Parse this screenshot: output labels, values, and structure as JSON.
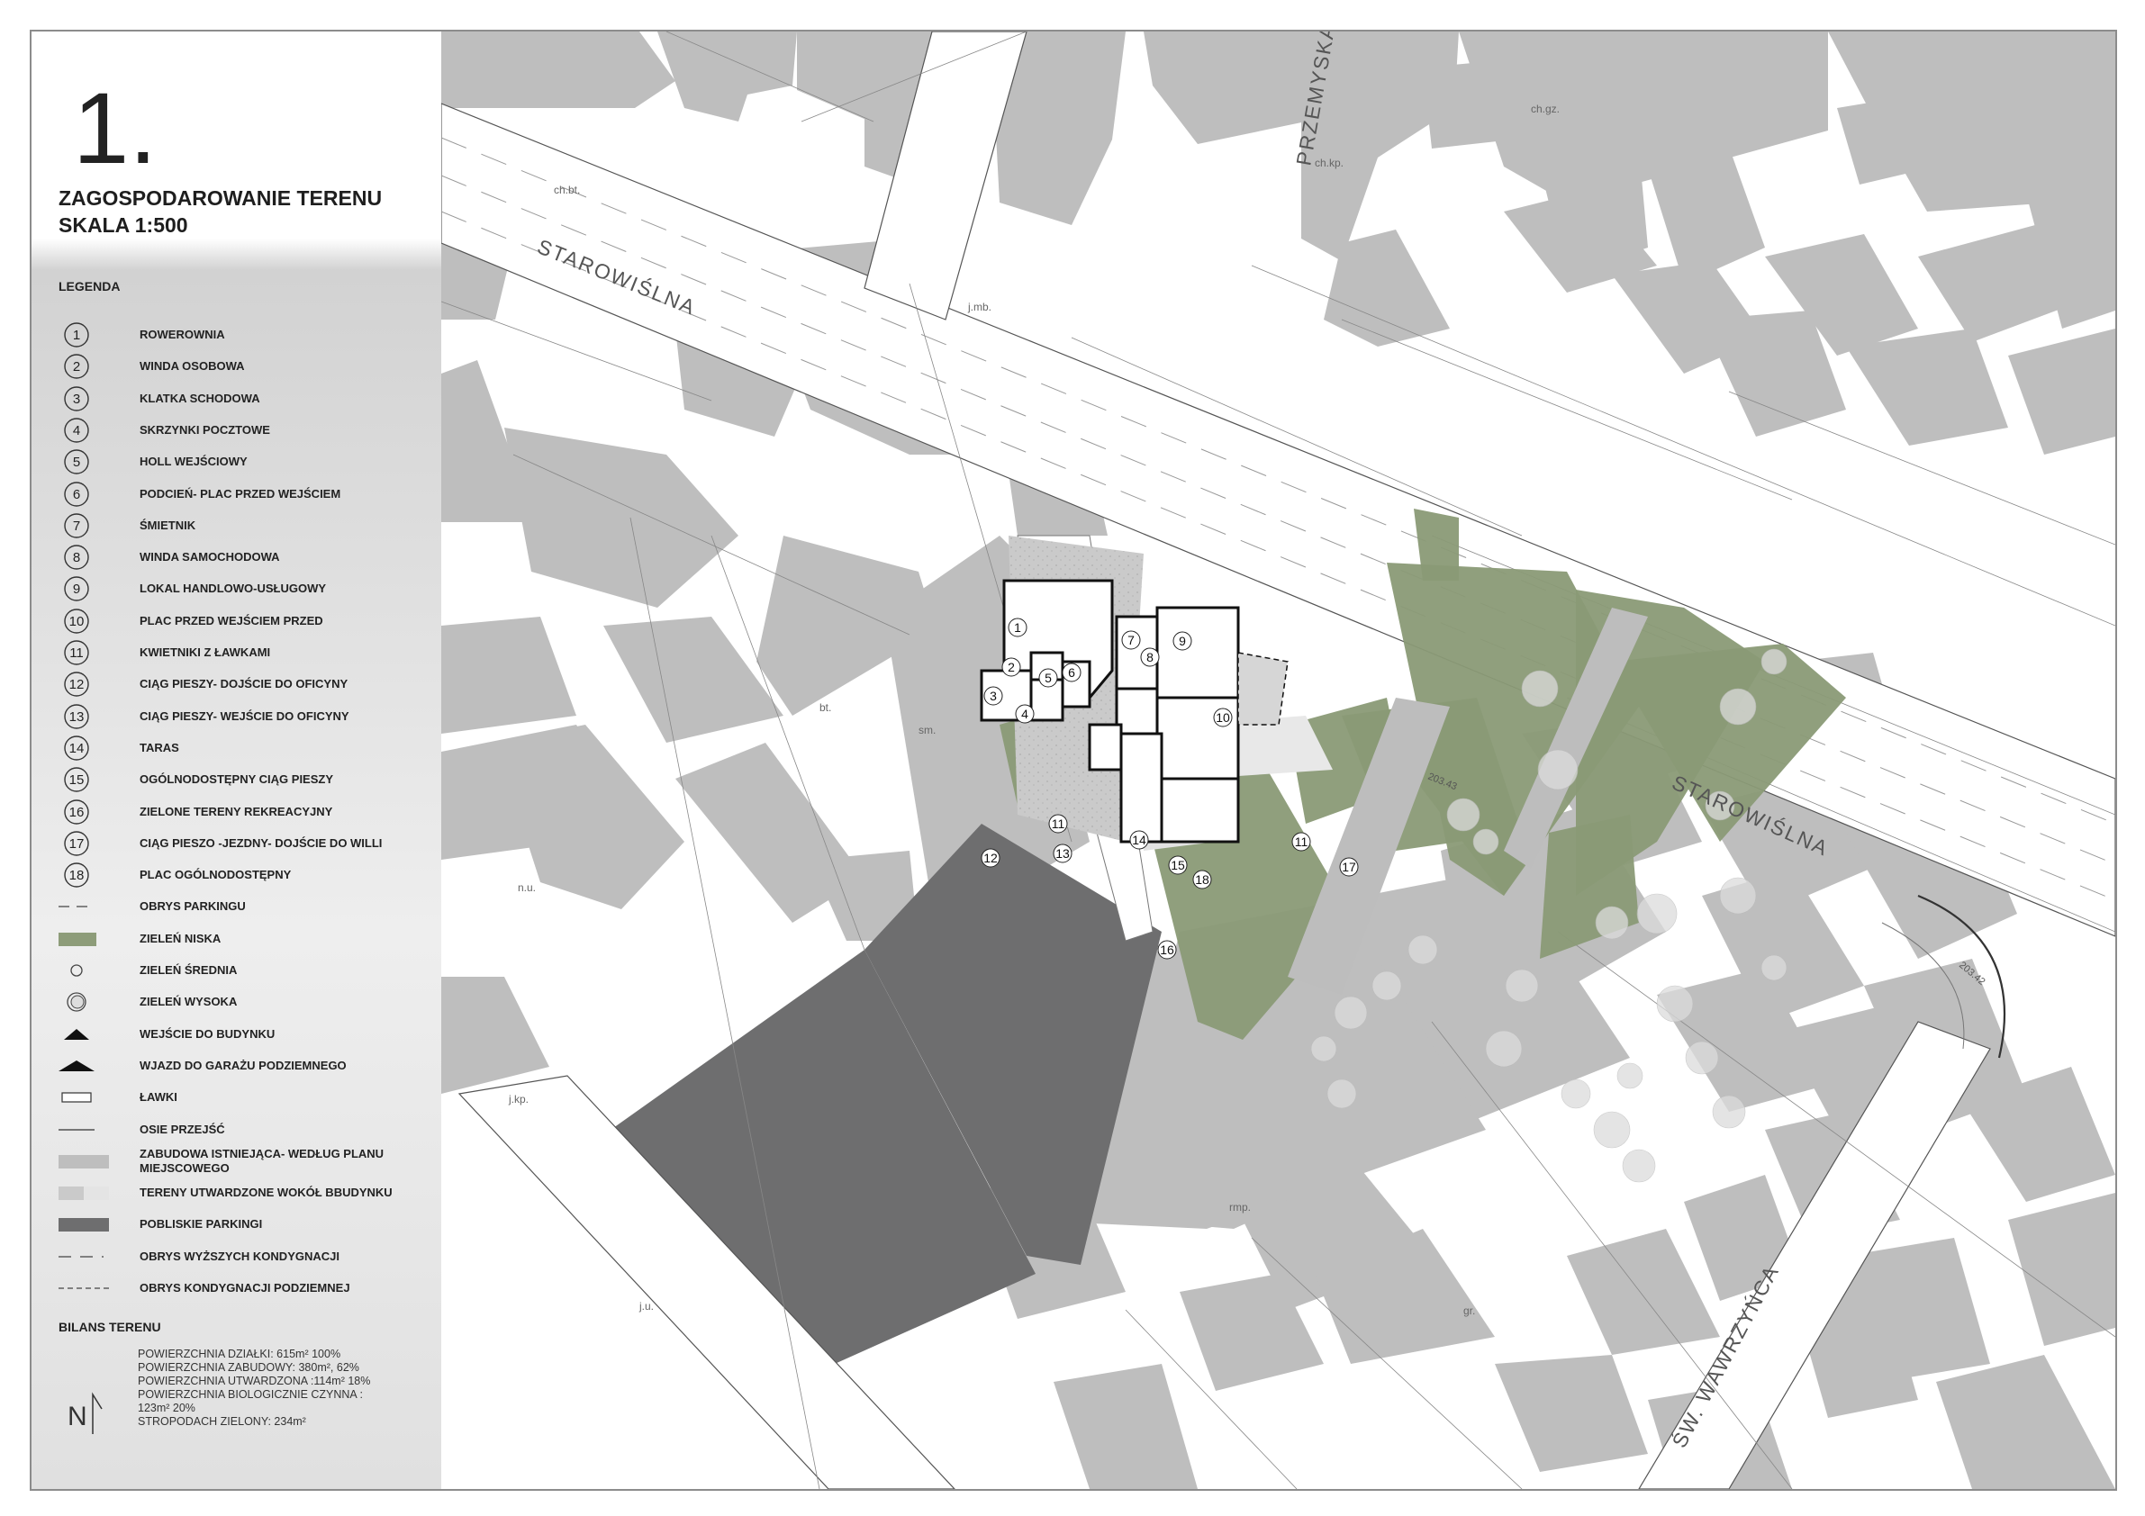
{
  "sheet": {
    "number": "1.",
    "title": "ZAGOSPODAROWANIE TERENU SKALA 1:500"
  },
  "legend": {
    "heading": "LEGENDA",
    "numbered": [
      {
        "n": "1",
        "label": "ROWEROWNIA"
      },
      {
        "n": "2",
        "label": "WINDA OSOBOWA"
      },
      {
        "n": "3",
        "label": "KLATKA SCHODOWA"
      },
      {
        "n": "4",
        "label": "SKRZYNKI POCZTOWE"
      },
      {
        "n": "5",
        "label": "HOLL WEJŚCIOWY"
      },
      {
        "n": "6",
        "label": "PODCIEŃ- PLAC PRZED WEJŚCIEM"
      },
      {
        "n": "7",
        "label": "ŚMIETNIK"
      },
      {
        "n": "8",
        "label": "WINDA SAMOCHODOWA"
      },
      {
        "n": "9",
        "label": "LOKAL HANDLOWO-USŁUGOWY"
      },
      {
        "n": "10",
        "label": "PLAC PRZED WEJŚCIEM PRZED"
      },
      {
        "n": "11",
        "label": "KWIETNIKI Z ŁAWKAMI"
      },
      {
        "n": "12",
        "label": "CIĄG PIESZY- DOJŚCIE DO OFICYNY"
      },
      {
        "n": "13",
        "label": "CIĄG PIESZY- WEJŚCIE DO OFICYNY"
      },
      {
        "n": "14",
        "label": "TARAS"
      },
      {
        "n": "15",
        "label": "OGÓLNODOSTĘPNY CIĄG PIESZY"
      },
      {
        "n": "16",
        "label": "ZIELONE TERENY REKREACYJNY"
      },
      {
        "n": "17",
        "label": "CIĄG PIESZO -JEZDNY- DOJŚCIE DO WILLI"
      },
      {
        "n": "18",
        "label": "PLAC OGÓLNODOSTĘPNY"
      }
    ],
    "symbols": [
      {
        "key": "parking-outline",
        "label": "OBRYS PARKINGU"
      },
      {
        "key": "low-greenery",
        "label": "ZIELEŃ NISKA"
      },
      {
        "key": "medium-greenery",
        "label": "ZIELEŃ ŚREDNIA"
      },
      {
        "key": "tall-greenery",
        "label": "ZIELEŃ WYSOKA"
      },
      {
        "key": "building-entrance",
        "label": "WEJŚCIE DO BUDYNKU"
      },
      {
        "key": "garage-entrance",
        "label": "WJAZD DO GARAŻU PODZIEMNEGO"
      },
      {
        "key": "bench",
        "label": "ŁAWKI"
      },
      {
        "key": "walk-axis",
        "label": "OSIE PRZEJŚĆ"
      },
      {
        "key": "existing-buildings",
        "label": "ZABUDOWA ISTNIEJĄCA- WEDŁUG PLANU MIEJSCOWEGO"
      },
      {
        "key": "paved-areas",
        "label": "TERENY UTWARDZONE WOKÓŁ BBUDYNKU"
      },
      {
        "key": "nearby-parking",
        "label": "POBLISKIE PARKINGI"
      },
      {
        "key": "upper-floors-outline",
        "label": "OBRYS WYŻSZYCH KONDYGNACJI"
      },
      {
        "key": "underground-outline",
        "label": "OBRYS  KONDYGNACJI PODZIEMNEJ"
      }
    ]
  },
  "bilans": {
    "heading": "BILANS TERENU",
    "north_letter": "N",
    "lines": [
      "POWIERZCHNIA DZIAŁKI: 615m² 100%",
      "POWIERZCHNIA ZABUDOWY: 380m², 62%",
      "POWIERZCHNIA UTWARDZONA :114m² 18%",
      "POWIERZCHNIA BIOLOGICZNIE CZYNNA :",
      "123m² 20%",
      "STROPODACH ZIELONY: 234m²"
    ]
  },
  "map": {
    "streets": [
      "STAROWIŚLNA",
      "STAROWIŚLNA",
      "PRZEMYSKA",
      "ŚW. WAWRZYŃCA"
    ],
    "elevations": [
      "203.43",
      "203.42"
    ],
    "lot_labels": [
      "ch.bt.",
      "j.mb.",
      "ch.kp.",
      "ch.gz.",
      "n.u.",
      "bt.",
      "sm.",
      "rmp.",
      "j.kp.",
      "gr.",
      "j.u."
    ],
    "plan_numbers": [
      "1",
      "2",
      "3",
      "4",
      "5",
      "6",
      "7",
      "8",
      "9",
      "10",
      "11",
      "12",
      "13",
      "14",
      "15",
      "16",
      "11",
      "17",
      "18"
    ]
  },
  "colors": {
    "existing_building": "#bebebe",
    "nearby_parking": "#6e6e6f",
    "low_greenery": "#8a9a76",
    "paved": "#c9c9c9",
    "road": "#ffffff"
  }
}
